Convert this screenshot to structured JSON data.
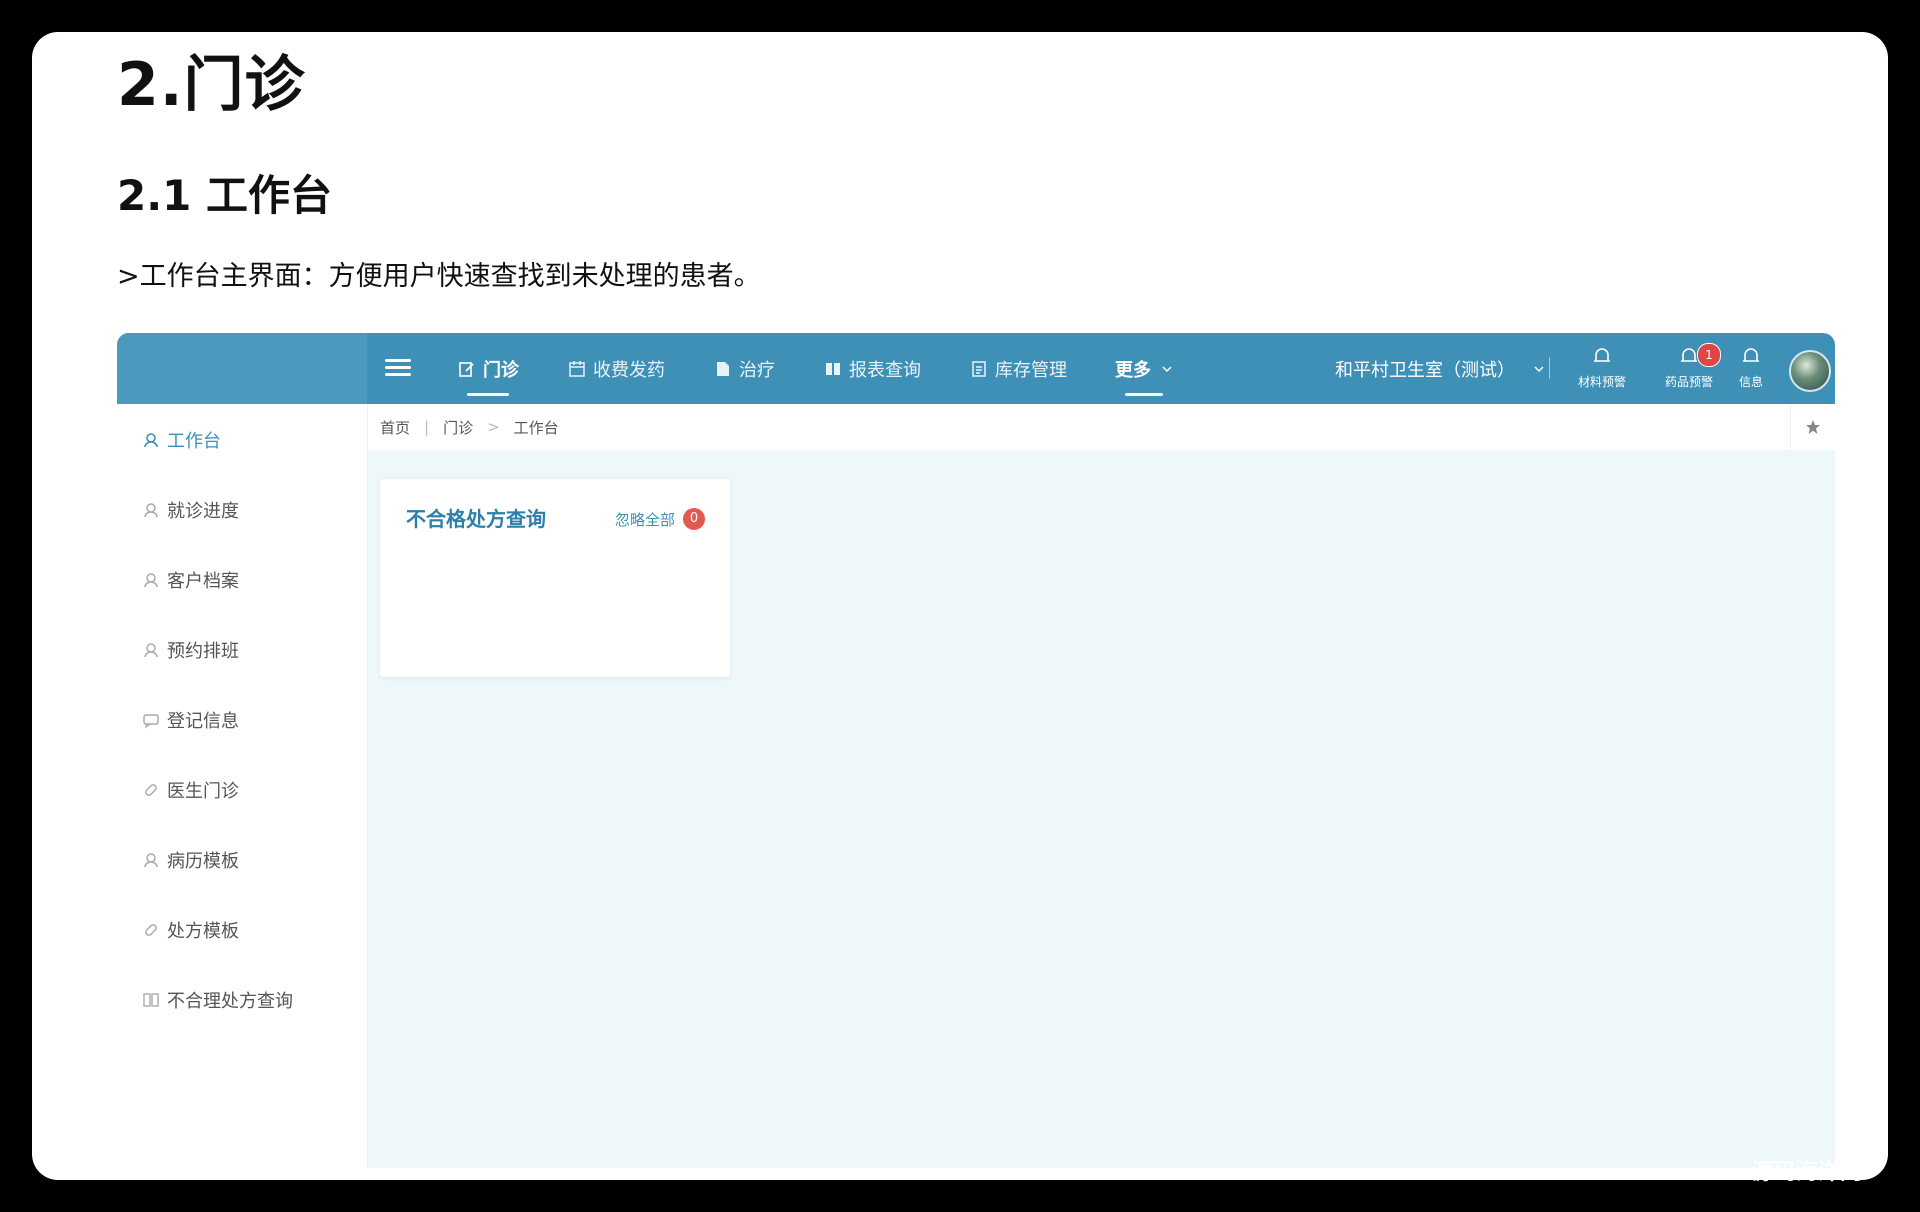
{
  "doc": {
    "h1": "2.门诊",
    "h2": "2.1 工作台",
    "intro": ">工作台主界面：方便用户快速查找到未处理的患者。"
  },
  "nav": {
    "items": [
      {
        "label": "门诊",
        "icon": "edit-icon",
        "active": true
      },
      {
        "label": "收费发药",
        "icon": "calendar-icon"
      },
      {
        "label": "治疗",
        "icon": "document-icon"
      },
      {
        "label": "报表查询",
        "icon": "book-icon"
      },
      {
        "label": "库存管理",
        "icon": "inventory-icon"
      },
      {
        "label": "更多",
        "icon": "chevron-down-icon"
      }
    ],
    "org": "和平村卫生室（测试）",
    "alerts": [
      {
        "label": "材料预警",
        "icon": "bell-icon",
        "badge": ""
      },
      {
        "label": "药品预警",
        "icon": "bell-icon",
        "badge": "1"
      },
      {
        "label": "信息",
        "icon": "bell-icon",
        "badge": ""
      }
    ]
  },
  "sidebar": {
    "items": [
      {
        "label": "工作台",
        "icon": "user-headset-icon",
        "active": true
      },
      {
        "label": "就诊进度",
        "icon": "user-headset-icon"
      },
      {
        "label": "客户档案",
        "icon": "user-headset-icon"
      },
      {
        "label": "预约排班",
        "icon": "user-headset-icon"
      },
      {
        "label": "登记信息",
        "icon": "chat-icon"
      },
      {
        "label": "医生门诊",
        "icon": "pill-icon"
      },
      {
        "label": "病历模板",
        "icon": "user-headset-icon"
      },
      {
        "label": "处方模板",
        "icon": "pill-icon"
      },
      {
        "label": "不合理处方查询",
        "icon": "book-icon"
      }
    ]
  },
  "breadcrumb": {
    "items": [
      "首页",
      "门诊",
      "工作台"
    ]
  },
  "card": {
    "title": "不合格处方查询",
    "action": "忽略全部",
    "count": "0"
  },
  "watermark": "源码海洋网",
  "colors": {
    "topbar": "#3f90b7",
    "content_bg": "#eef8fb",
    "accent": "#2d7ea8",
    "badge": "#e04646"
  }
}
